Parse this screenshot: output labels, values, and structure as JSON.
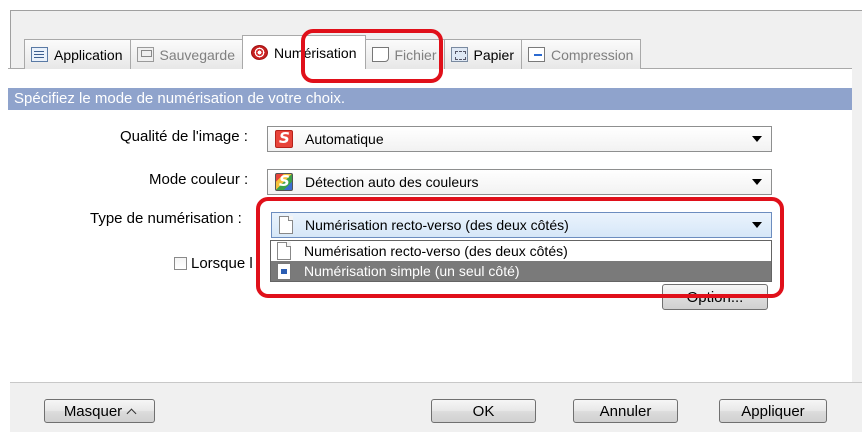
{
  "tabs": [
    {
      "label": "Application",
      "icon": "application-icon",
      "enabled": true
    },
    {
      "label": "Sauvegarde",
      "icon": "save-icon",
      "enabled": false
    },
    {
      "label": "Numérisation",
      "icon": "scan-icon",
      "enabled": true,
      "active": true
    },
    {
      "label": "Fichier",
      "icon": "file-icon",
      "enabled": false
    },
    {
      "label": "Papier",
      "icon": "paper-icon",
      "enabled": true
    },
    {
      "label": "Compression",
      "icon": "compression-icon",
      "enabled": false
    }
  ],
  "banner": "Spécifiez le mode de numérisation de votre choix.",
  "fields": {
    "image_quality": {
      "label": "Qualité de l'image :",
      "value": "Automatique",
      "icon": "auto-s-icon"
    },
    "color_mode": {
      "label": "Mode couleur :",
      "value": "Détection auto des couleurs",
      "icon": "color-s-icon"
    },
    "scan_type": {
      "label": "Type de numérisation :",
      "value": "Numérisation recto-verso (des deux côtés)",
      "icon": "duplex-doc-icon",
      "options": [
        "Numérisation recto-verso (des deux côtés)",
        "Numérisation simple (un seul côté)"
      ],
      "highlighted_option": "Numérisation simple (un seul côté)"
    }
  },
  "checkbox_label_partial": "Lorsque l",
  "option_button": "Option...",
  "footer": {
    "hide": "Masquer",
    "ok": "OK",
    "cancel": "Annuler",
    "apply": "Appliquer"
  },
  "colors": {
    "highlight_red": "#e0101a",
    "banner_blue": "#8fa3cc",
    "selected_gray": "#7a7a7a"
  }
}
